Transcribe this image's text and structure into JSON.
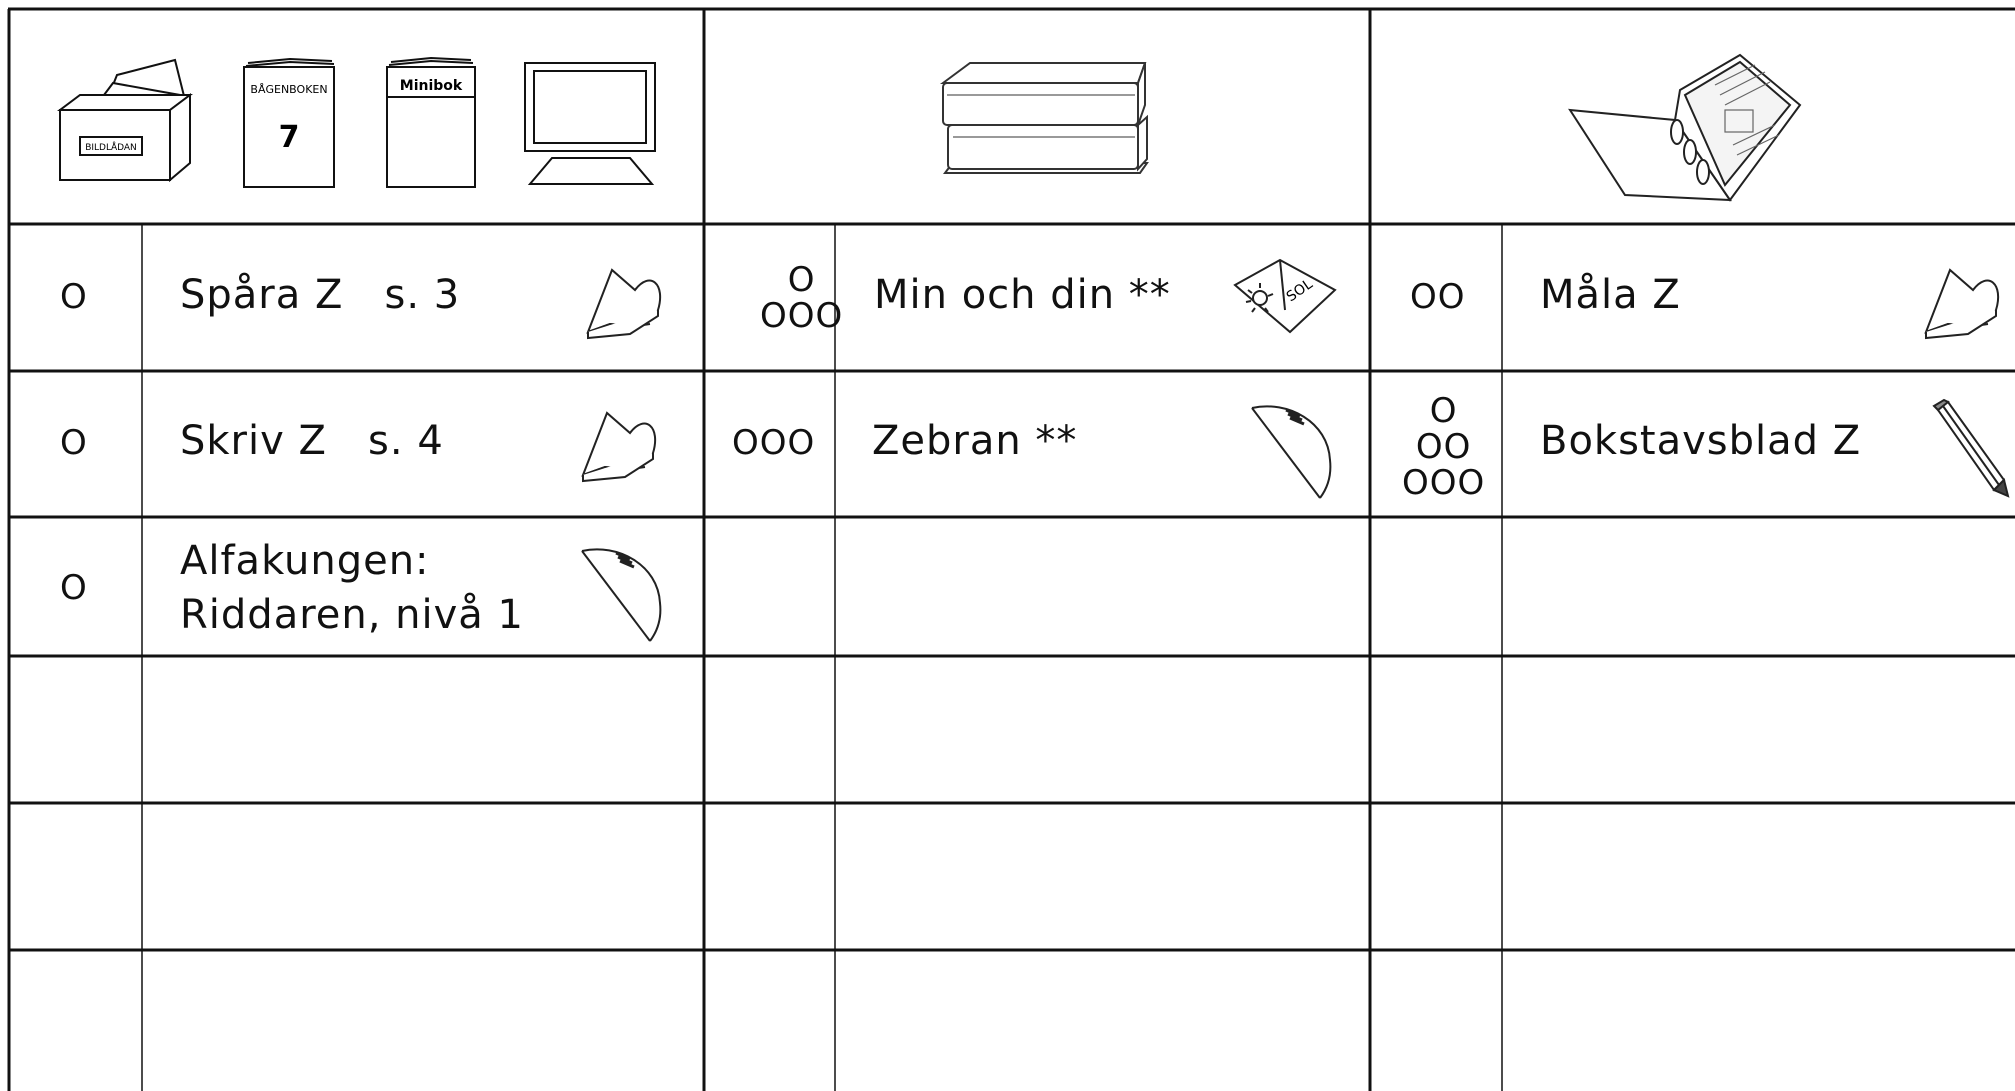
{
  "header": {
    "group1": {
      "bildladan_label": "BILDLÅDAN",
      "bagenboken_label": "BÅGENBOKEN",
      "bagenboken_number": "7",
      "minibok_label": "Minibok"
    }
  },
  "rows": [
    {
      "c1": {
        "level": "O",
        "task": "Spåra Z   s. 3",
        "icon": "heart-icon"
      },
      "c2": {
        "level_top": "O",
        "level_bottom": "OOO",
        "task": "Min och din **",
        "icon": "sol-book-icon",
        "icon_text": "SOL"
      },
      "c3": {
        "level": "OO",
        "task": "Måla Z",
        "icon": "heart-icon"
      }
    },
    {
      "c1": {
        "level": "O",
        "task": "Skriv Z   s. 4",
        "icon": "heart-icon"
      },
      "c2": {
        "level": "OOO",
        "task": "Zebran **",
        "icon": "bow-icon"
      },
      "c3": {
        "level_1": "O",
        "level_2": "OO",
        "level_3": "OOO",
        "task": "Bokstavsblad Z",
        "icon": "pencil-icon"
      }
    },
    {
      "c1": {
        "level": "O",
        "task_line1": "Alfakungen:",
        "task_line2": "Riddaren, nivå 1",
        "icon": "bow-icon"
      }
    }
  ]
}
